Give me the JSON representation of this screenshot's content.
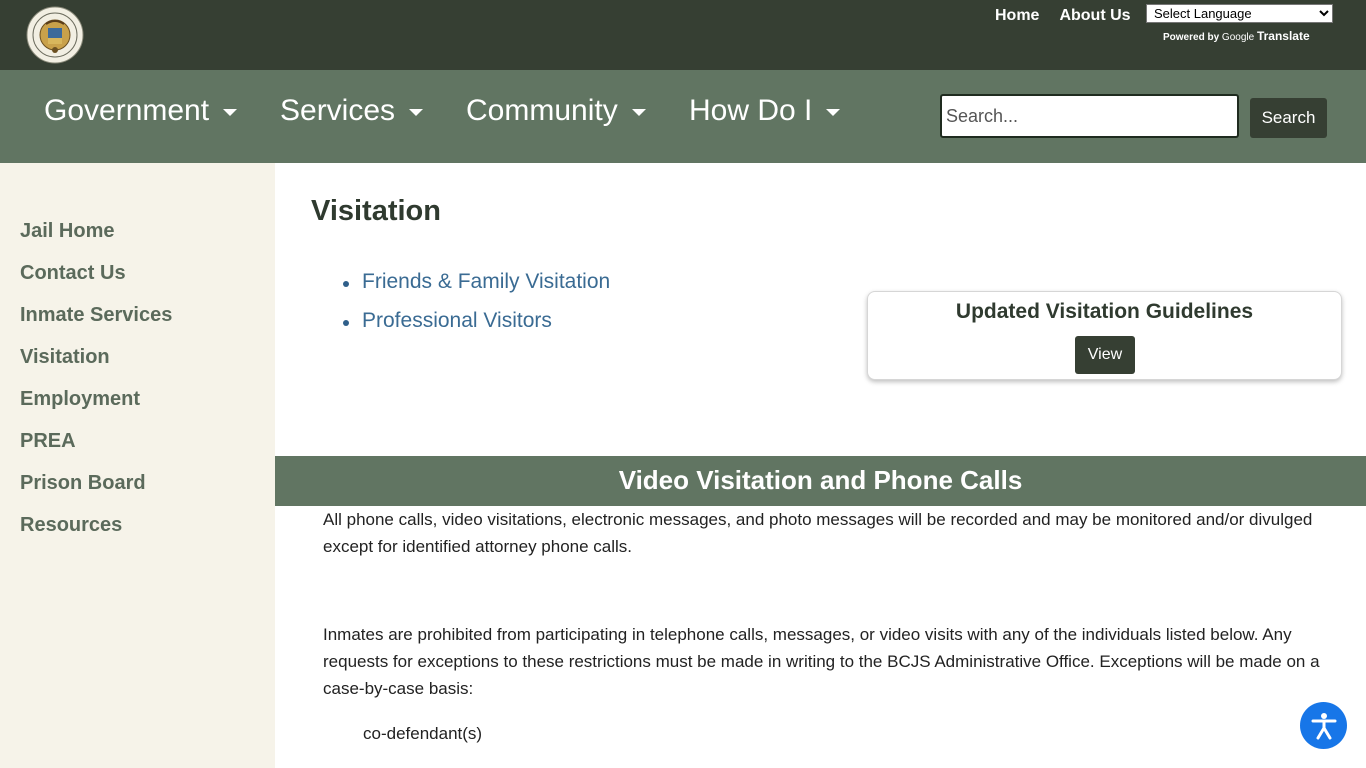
{
  "header": {
    "links": [
      {
        "label": "Home"
      },
      {
        "label": "About Us"
      }
    ],
    "language_select": {
      "selected": "Select Language"
    },
    "powered_by": "Powered by",
    "google": "Google",
    "translate": "Translate"
  },
  "nav": {
    "items": [
      {
        "label": "Government"
      },
      {
        "label": "Services"
      },
      {
        "label": "Community"
      },
      {
        "label": "How Do I"
      }
    ],
    "search": {
      "placeholder": "Search...",
      "button_label": "Search"
    }
  },
  "sidebar": {
    "items": [
      {
        "label": "Jail Home"
      },
      {
        "label": "Contact Us"
      },
      {
        "label": "Inmate Services"
      },
      {
        "label": "Visitation"
      },
      {
        "label": "Employment"
      },
      {
        "label": "PREA"
      },
      {
        "label": "Prison Board"
      },
      {
        "label": "Resources"
      }
    ]
  },
  "main": {
    "title": "Visitation",
    "links": [
      {
        "label": "Friends & Family Visitation"
      },
      {
        "label": "Professional Visitors"
      }
    ],
    "card": {
      "title": "Updated Visitation Guidelines",
      "button_label": "View"
    },
    "section_heading": "Video Visitation and Phone Calls",
    "paragraph_1": "All phone calls, video visitations, electronic messages, and photo messages will be recorded and may be monitored and/or divulged except for identified attorney phone calls.",
    "paragraph_2": "Inmates are prohibited from participating in telephone calls, messages, or video visits with any of the individuals listed below. Any requests for exceptions to these restrictions must be made in writing to the BCJS Administrative Office. Exceptions will be made on a case-by-case basis:",
    "list_item_1": "co-defendant(s)"
  },
  "colors": {
    "topbar": "#363f33",
    "navbar": "#617562",
    "sidebar": "#f6f3e9",
    "link": "#3a6b93",
    "accessibility_button": "#1776e8"
  },
  "icons": {
    "seal": "county-seal-icon",
    "caret": "caret-down-icon",
    "accessibility": "accessibility-icon"
  }
}
